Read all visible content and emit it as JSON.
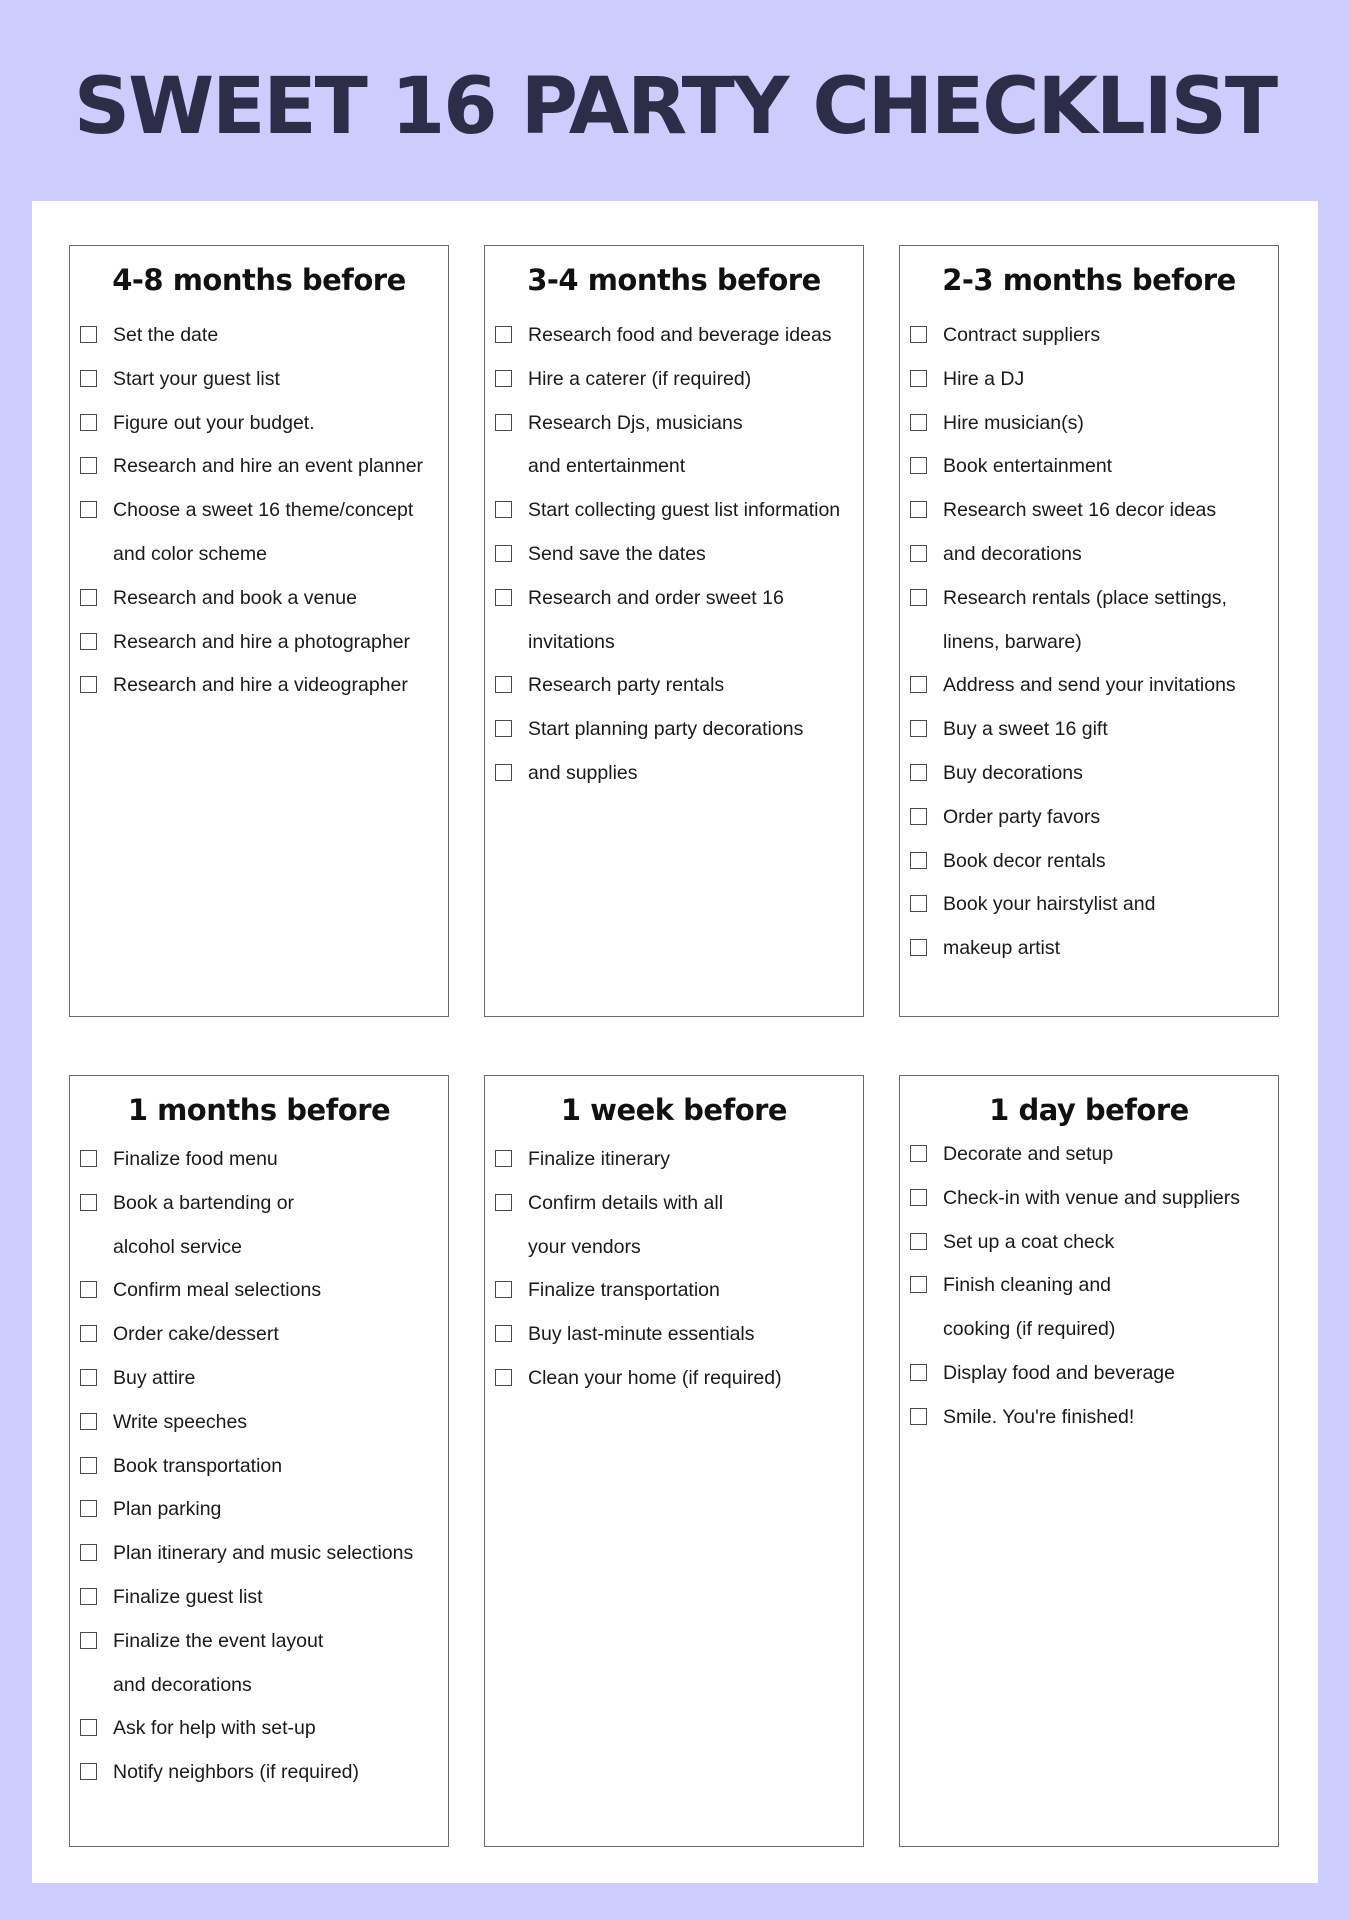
{
  "title": "SWEET 16 PARTY CHECKLIST",
  "colors": {
    "background": "#ccccff",
    "title": "#2e2d48",
    "panel": "#ffffff",
    "box_border": "#6b6b6b"
  },
  "sections": [
    {
      "heading": "4-8 months before",
      "lines": [
        {
          "text": "Set the date",
          "checkbox": true
        },
        {
          "text": "Start your guest list",
          "checkbox": true
        },
        {
          "text": "Figure out your budget.",
          "checkbox": true
        },
        {
          "text": "Research and hire an event planner",
          "checkbox": true
        },
        {
          "text": "Choose a sweet 16 theme/concept",
          "checkbox": true
        },
        {
          "text": "and color scheme",
          "checkbox": false
        },
        {
          "text": "Research and book a venue",
          "checkbox": true
        },
        {
          "text": "Research and hire a photographer",
          "checkbox": true
        },
        {
          "text": "Research and hire a videographer",
          "checkbox": true
        }
      ]
    },
    {
      "heading": "3-4 months before",
      "lines": [
        {
          "text": "Research food and beverage ideas",
          "checkbox": true
        },
        {
          "text": "Hire a caterer (if required)",
          "checkbox": true
        },
        {
          "text": "Research Djs, musicians",
          "checkbox": true
        },
        {
          "text": "and entertainment",
          "checkbox": false
        },
        {
          "text": "Start collecting guest list information",
          "checkbox": true
        },
        {
          "text": "Send save the dates",
          "checkbox": true
        },
        {
          "text": "Research and order sweet 16",
          "checkbox": true
        },
        {
          "text": "invitations",
          "checkbox": false
        },
        {
          "text": "Research party rentals",
          "checkbox": true
        },
        {
          "text": "Start planning party decorations",
          "checkbox": true
        },
        {
          "text": "and supplies",
          "checkbox": true
        }
      ]
    },
    {
      "heading": "2-3 months before",
      "lines": [
        {
          "text": "Contract suppliers",
          "checkbox": true
        },
        {
          "text": "Hire a DJ",
          "checkbox": true
        },
        {
          "text": "Hire musician(s)",
          "checkbox": true
        },
        {
          "text": "Book entertainment",
          "checkbox": true
        },
        {
          "text": "Research sweet 16 decor ideas",
          "checkbox": true
        },
        {
          "text": "and decorations",
          "checkbox": true
        },
        {
          "text": "Research rentals (place settings,",
          "checkbox": true
        },
        {
          "text": "linens, barware)",
          "checkbox": false
        },
        {
          "text": "Address and send your invitations",
          "checkbox": true
        },
        {
          "text": "Buy a sweet 16 gift",
          "checkbox": true
        },
        {
          "text": "Buy decorations",
          "checkbox": true
        },
        {
          "text": "Order party favors",
          "checkbox": true
        },
        {
          "text": "Book decor rentals",
          "checkbox": true
        },
        {
          "text": "Book your hairstylist and",
          "checkbox": true
        },
        {
          "text": "makeup artist",
          "checkbox": true
        }
      ]
    },
    {
      "heading": "1 months before",
      "lines": [
        {
          "text": "Finalize food menu",
          "checkbox": true
        },
        {
          "text": "Book a bartending or",
          "checkbox": true
        },
        {
          "text": "alcohol service",
          "checkbox": false
        },
        {
          "text": "Confirm meal selections",
          "checkbox": true
        },
        {
          "text": "Order cake/dessert",
          "checkbox": true
        },
        {
          "text": "Buy attire",
          "checkbox": true
        },
        {
          "text": "Write speeches",
          "checkbox": true
        },
        {
          "text": "Book transportation",
          "checkbox": true
        },
        {
          "text": "Plan parking",
          "checkbox": true
        },
        {
          "text": "Plan itinerary and music selections",
          "checkbox": true
        },
        {
          "text": "Finalize guest list",
          "checkbox": true
        },
        {
          "text": "Finalize the event layout",
          "checkbox": true
        },
        {
          "text": "and decorations",
          "checkbox": false
        },
        {
          "text": "Ask for help with set-up",
          "checkbox": true
        },
        {
          "text": "Notify neighbors (if required)",
          "checkbox": true
        }
      ]
    },
    {
      "heading": "1 week before",
      "lines": [
        {
          "text": "Finalize itinerary",
          "checkbox": true
        },
        {
          "text": "Confirm details with all",
          "checkbox": true
        },
        {
          "text": "your vendors",
          "checkbox": false
        },
        {
          "text": "Finalize transportation",
          "checkbox": true
        },
        {
          "text": "Buy last-minute essentials",
          "checkbox": true
        },
        {
          "text": "Clean your home (if required)",
          "checkbox": true
        }
      ]
    },
    {
      "heading": "1 day before",
      "lines": [
        {
          "text": "Decorate and setup",
          "checkbox": true
        },
        {
          "text": "Check-in with venue and suppliers",
          "checkbox": true
        },
        {
          "text": "Set up a coat check",
          "checkbox": true
        },
        {
          "text": "Finish cleaning and",
          "checkbox": true
        },
        {
          "text": "cooking (if required)",
          "checkbox": false
        },
        {
          "text": "Display food and beverage",
          "checkbox": true
        },
        {
          "text": "Smile. You're finished!",
          "checkbox": true
        }
      ]
    }
  ]
}
